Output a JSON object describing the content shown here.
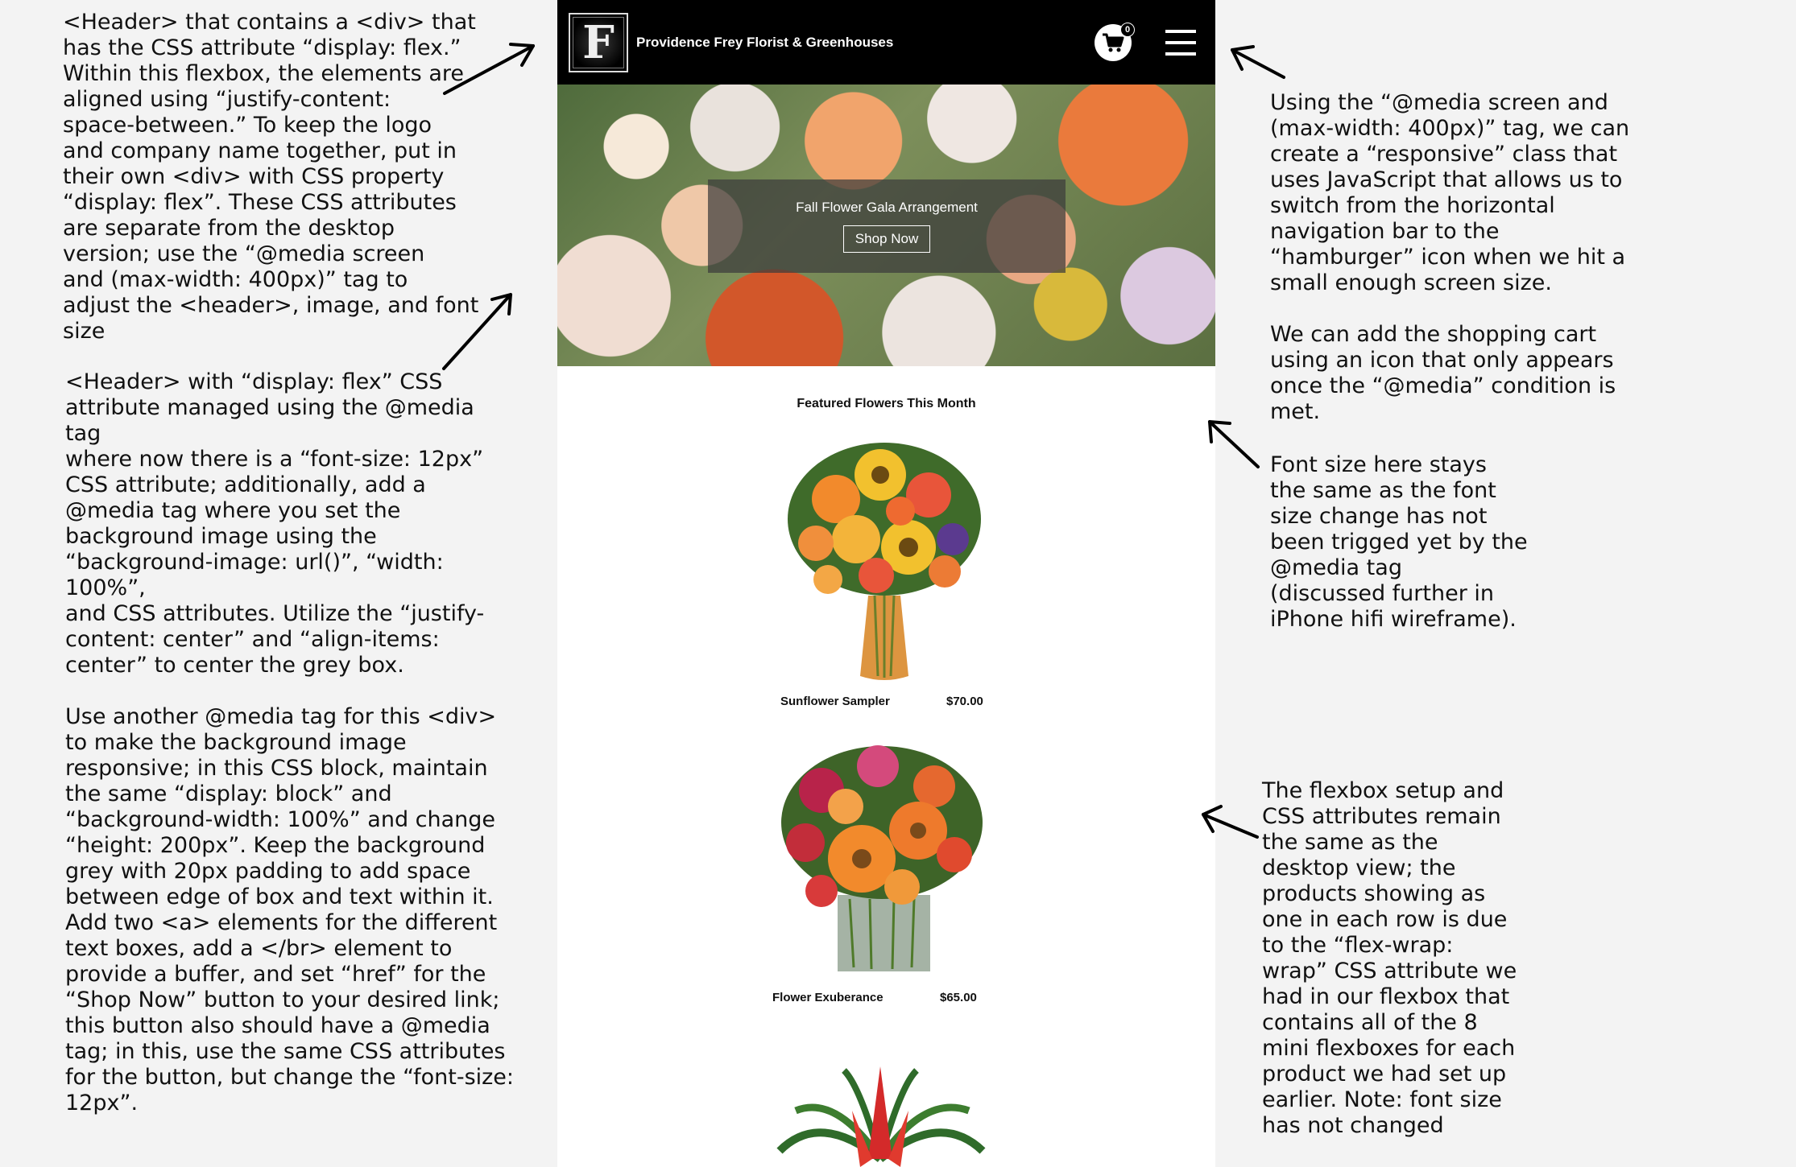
{
  "annotations": {
    "left_1": "<Header> that contains a <div> that\nhas the CSS attribute “display: flex.”\nWithin this flexbox, the elements are\naligned using  “justify-content:\nspace-between.” To keep the logo\nand company name together, put in\ntheir own <div> with CSS property\n“display: flex”. These CSS attributes\nare separate from the desktop\nversion; use the “@media screen\nand (max-width: 400px)” tag to\nadjust the <header>, image, and font\nsize",
    "left_2": "<Header> with “display: flex” CSS\nattribute managed using the @media tag\nwhere now there is a “font-size: 12px”\nCSS attribute; additionally, add a\n@media tag where you set the\nbackground image using the\n“background-image: url()”, “width: 100%”,\nand  CSS attributes. Utilize the “justify-\ncontent: center” and “align-items:\ncenter” to center the grey box.\n\nUse another @media tag for this <div>\nto make the background image\nresponsive; in this CSS block, maintain\nthe same “display: block” and\n“background-width: 100%” and change\n“height: 200px”. Keep the background\ngrey with 20px padding to add space\nbetween edge of box and text within it.\nAdd two <a> elements for the different\ntext boxes, add a </br> element to\nprovide a buffer, and set “href” for the\n“Shop Now” button to your desired link;\nthis button also should have a @media\ntag; in this, use the same CSS attributes\nfor the button, but change the “font-size:\n12px”.",
    "right_1": "Using the “@media screen and\n(max-width: 400px)” tag, we can\ncreate a “responsive” class that\nuses JavaScript that allows us to\nswitch from the horizontal\nnavigation bar to the\n“hamburger” icon when we hit a\nsmall enough screen size.\n\nWe can add the shopping cart\nusing an icon that only appears\nonce the “@media” condition is\nmet.",
    "right_2": "Font size here stays\nthe same as the font\nsize change has not\nbeen trigged yet by the\n@media tag\n(discussed further in\niPhone hifi wireframe).",
    "right_3": "The flexbox setup and\nCSS attributes remain\nthe same as the\ndesktop view; the\nproducts showing as\none in each row is due\nto the “flex-wrap:\nwrap” CSS attribute we\nhad in our flexbox that\ncontains all of the 8\nmini flexboxes for each\nproduct we had set up\nearlier. Note: font size\nhas not changed"
  },
  "header": {
    "logo_letter": "F",
    "company_name": "Providence Frey Florist & Greenhouses",
    "cart_count": "0",
    "cart_icon": "shopping-cart-icon",
    "menu_icon": "hamburger-menu-icon"
  },
  "hero": {
    "title": "Fall Flower Gala Arrangement",
    "button_label": "Shop Now"
  },
  "featured": {
    "title": "Featured Flowers This Month",
    "products": [
      {
        "name": "Sunflower Sampler",
        "price": "$70.00"
      },
      {
        "name": "Flower Exuberance",
        "price": "$65.00"
      },
      {
        "name": "",
        "price": ""
      }
    ]
  },
  "colors": {
    "page_background": "#f3f3f3",
    "header_background": "#000000",
    "hero_overlay": "#3c3c3c"
  }
}
